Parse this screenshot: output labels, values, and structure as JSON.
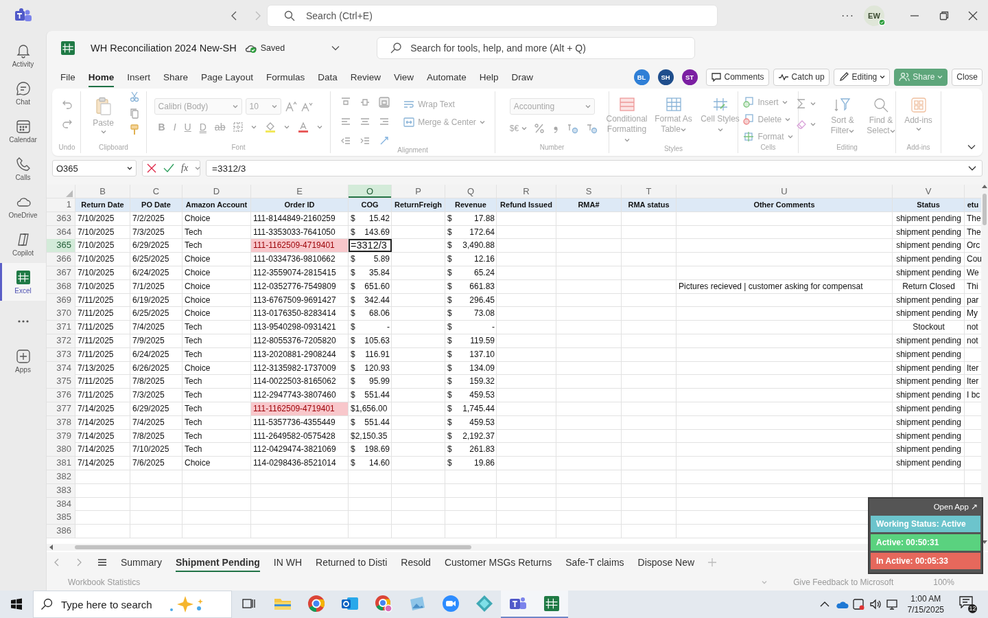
{
  "app_bar": {
    "search_placeholder": "Search (Ctrl+E)",
    "more": "···",
    "avatar": "EW"
  },
  "rail": [
    {
      "kind": "activity",
      "label": "Activity",
      "selected": false
    },
    {
      "kind": "chat",
      "label": "Chat",
      "selected": false
    },
    {
      "kind": "calendar",
      "label": "Calendar",
      "selected": false
    },
    {
      "kind": "calls",
      "label": "Calls",
      "selected": false
    },
    {
      "kind": "onedrive",
      "label": "OneDrive",
      "selected": false
    },
    {
      "kind": "copilot",
      "label": "Copilot",
      "selected": false
    },
    {
      "kind": "excel",
      "label": "Excel",
      "selected": true
    },
    {
      "kind": "more",
      "selected": false
    },
    {
      "kind": "apps",
      "label": "Apps",
      "selected": false
    }
  ],
  "workbook": {
    "title": "WH Reconciliation 2024 New-SH",
    "save_status": "Saved",
    "search_placeholder": "Search for tools, help, and more (Alt + Q)"
  },
  "ribbon_tabs": [
    {
      "label": "File",
      "selected": false
    },
    {
      "label": "Home",
      "selected": true
    },
    {
      "label": "Insert",
      "selected": false
    },
    {
      "label": "Share",
      "selected": false
    },
    {
      "label": "Page Layout",
      "selected": false
    },
    {
      "label": "Formulas",
      "selected": false
    },
    {
      "label": "Data",
      "selected": false
    },
    {
      "label": "Review",
      "selected": false
    },
    {
      "label": "View",
      "selected": false
    },
    {
      "label": "Automate",
      "selected": false
    },
    {
      "label": "Help",
      "selected": false
    },
    {
      "label": "Draw",
      "selected": false
    }
  ],
  "collaborators": [
    {
      "initials": "BL",
      "color": "#2f7fd6"
    },
    {
      "initials": "SH",
      "color": "#1f4e8c"
    },
    {
      "initials": "ST",
      "color": "#7b1fa2"
    }
  ],
  "actions": [
    {
      "kind": "comments",
      "label": "Comments"
    },
    {
      "kind": "catchup",
      "label": "Catch up"
    },
    {
      "kind": "editing",
      "label": "Editing"
    },
    {
      "kind": "share",
      "label": "Share"
    },
    {
      "kind": "close",
      "label": "Close"
    }
  ],
  "ribbon": {
    "groups": [
      {
        "kind": "undo",
        "label": "Undo"
      },
      {
        "kind": "clipboard",
        "label": "Clipboard",
        "paste": "Paste"
      },
      {
        "kind": "font",
        "label": "Font",
        "font": "Calibri (Body)",
        "size": "10",
        "styles": [
          "B",
          "I",
          "U",
          "D",
          "ab"
        ]
      },
      {
        "kind": "alignment",
        "label": "Alignment",
        "wrap": "Wrap Text",
        "merge": "Merge & Center"
      },
      {
        "kind": "number",
        "label": "Number",
        "format": "Accounting",
        "currency": "$€"
      },
      {
        "kind": "styles",
        "label": "Styles",
        "buttons": [
          "Conditional Formatting",
          "Format As Table",
          "Cell Styles"
        ]
      },
      {
        "kind": "cells",
        "label": "Cells",
        "buttons": [
          "Insert",
          "Delete",
          "Format"
        ]
      },
      {
        "kind": "editing",
        "label": "Editing",
        "buttons": [
          "Sort & Filter",
          "Find & Select"
        ]
      },
      {
        "kind": "addins",
        "label": "Add-ins",
        "buttons": [
          "Add-ins"
        ]
      }
    ]
  },
  "formula_bar": {
    "name_box": "O365",
    "function_label": "fx",
    "formula": "=3312/3"
  },
  "sheet": {
    "header_row": "1",
    "columns": [
      {
        "letter": "B",
        "heading": "Return Date",
        "kind": "text",
        "selected": false
      },
      {
        "letter": "C",
        "heading": "PO Date",
        "kind": "text",
        "selected": false
      },
      {
        "letter": "D",
        "heading": "Amazon Account",
        "kind": "text",
        "selected": false
      },
      {
        "letter": "E",
        "heading": "Order ID",
        "kind": "id",
        "selected": false
      },
      {
        "letter": "O",
        "heading": "COG",
        "kind": "money",
        "selected": true
      },
      {
        "letter": "P",
        "heading": "ReturnFreigh",
        "kind": "text",
        "selected": false
      },
      {
        "letter": "Q",
        "heading": "Revenue",
        "kind": "money",
        "selected": false
      },
      {
        "letter": "R",
        "heading": "Refund Issued",
        "kind": "text",
        "selected": false
      },
      {
        "letter": "S",
        "heading": "RMA#",
        "kind": "text",
        "selected": false
      },
      {
        "letter": "T",
        "heading": "RMA status",
        "kind": "text",
        "selected": false
      },
      {
        "letter": "U",
        "heading": "Other Comments",
        "kind": "text",
        "selected": false
      },
      {
        "letter": "V",
        "heading": "Status",
        "kind": "status",
        "selected": false
      },
      {
        "heading": "etu",
        "kind": "text",
        "selected": false
      }
    ],
    "rows": [
      {
        "number": "363",
        "selected": false,
        "highlighted": false,
        "cells": [
          "7/10/2025",
          "7/2/2025",
          "Choice",
          "111-8144849-2160259",
          [
            "$",
            "15.42"
          ],
          null,
          [
            "$",
            "17.88"
          ],
          null,
          null,
          null,
          null,
          "shipment pending",
          "The"
        ]
      },
      {
        "number": "364",
        "selected": false,
        "highlighted": false,
        "cells": [
          "7/10/2025",
          "7/3/2025",
          "Tech",
          "111-3353033-7641050",
          [
            "$",
            "143.69"
          ],
          null,
          [
            "$",
            "172.64"
          ],
          null,
          null,
          null,
          null,
          "shipment pending",
          "The"
        ]
      },
      {
        "number": "365",
        "selected": true,
        "highlighted": true,
        "cells": [
          "7/10/2025",
          "6/29/2025",
          "Tech",
          "111-1162509-4719401",
          "=3312/3",
          null,
          [
            "$",
            "3,490.88"
          ],
          null,
          null,
          null,
          null,
          "shipment pending",
          "Orc"
        ]
      },
      {
        "number": "366",
        "selected": false,
        "highlighted": false,
        "cells": [
          "7/10/2025",
          "6/25/2025",
          "Choice",
          "111-0334736-9810662",
          [
            "$",
            "5.89"
          ],
          null,
          [
            "$",
            "12.16"
          ],
          null,
          null,
          null,
          null,
          "shipment pending",
          "Cou"
        ]
      },
      {
        "number": "367",
        "selected": false,
        "highlighted": false,
        "cells": [
          "7/10/2025",
          "6/24/2025",
          "Choice",
          "112-3559074-2815415",
          [
            "$",
            "35.84"
          ],
          null,
          [
            "$",
            "65.24"
          ],
          null,
          null,
          null,
          null,
          "shipment pending",
          "We"
        ]
      },
      {
        "number": "368",
        "selected": false,
        "highlighted": false,
        "cells": [
          "7/10/2025",
          "7/1/2025",
          "Choice",
          "112-0352776-7549809",
          [
            "$",
            "651.60"
          ],
          null,
          [
            "$",
            "661.83"
          ],
          null,
          null,
          null,
          "Pictures recieved | customer asking for compensat",
          "Return Closed",
          "Thi"
        ]
      },
      {
        "number": "369",
        "selected": false,
        "highlighted": false,
        "cells": [
          "7/11/2025",
          "6/19/2025",
          "Choice",
          "113-6767509-9691427",
          [
            "$",
            "342.44"
          ],
          null,
          [
            "$",
            "296.45"
          ],
          null,
          null,
          null,
          null,
          "shipment pending",
          "par"
        ]
      },
      {
        "number": "370",
        "selected": false,
        "highlighted": false,
        "cells": [
          "7/11/2025",
          "6/25/2025",
          "Choice",
          "113-0176350-8283414",
          [
            "$",
            "68.06"
          ],
          null,
          [
            "$",
            "73.08"
          ],
          null,
          null,
          null,
          null,
          "shipment pending",
          "My"
        ]
      },
      {
        "number": "371",
        "selected": false,
        "highlighted": false,
        "cells": [
          "7/11/2025",
          "7/4/2025",
          "Tech",
          "113-9540298-0931421",
          [
            "$",
            "-"
          ],
          null,
          [
            "$",
            "-"
          ],
          null,
          null,
          null,
          null,
          "Stockout",
          "not"
        ]
      },
      {
        "number": "372",
        "selected": false,
        "highlighted": false,
        "cells": [
          "7/11/2025",
          "7/9/2025",
          "Tech",
          "112-8055376-7205820",
          [
            "$",
            "105.63"
          ],
          null,
          [
            "$",
            "119.59"
          ],
          null,
          null,
          null,
          null,
          "shipment pending",
          "not"
        ]
      },
      {
        "number": "373",
        "selected": false,
        "highlighted": false,
        "cells": [
          "7/11/2025",
          "6/24/2025",
          "Tech",
          "113-2020881-2908244",
          [
            "$",
            "116.91"
          ],
          null,
          [
            "$",
            "137.10"
          ],
          null,
          null,
          null,
          null,
          "shipment pending",
          null
        ]
      },
      {
        "number": "374",
        "selected": false,
        "highlighted": false,
        "cells": [
          "7/13/2025",
          "6/26/2025",
          "Choice",
          "112-3135982-1737009",
          [
            "$",
            "120.93"
          ],
          null,
          [
            "$",
            "134.09"
          ],
          null,
          null,
          null,
          null,
          "shipment pending",
          "Iter"
        ]
      },
      {
        "number": "375",
        "selected": false,
        "highlighted": false,
        "cells": [
          "7/11/2025",
          "7/8/2025",
          "Tech",
          "114-0022503-8165062",
          [
            "$",
            "95.99"
          ],
          null,
          [
            "$",
            "159.32"
          ],
          null,
          null,
          null,
          null,
          "shipment pending",
          "Iter"
        ]
      },
      {
        "number": "376",
        "selected": false,
        "highlighted": false,
        "cells": [
          "7/11/2025",
          "7/3/2025",
          "Tech",
          "112-2947743-3807460",
          [
            "$",
            "551.44"
          ],
          null,
          [
            "$",
            "459.53"
          ],
          null,
          null,
          null,
          null,
          "shipment pending",
          "I bc"
        ]
      },
      {
        "number": "377",
        "selected": false,
        "highlighted": true,
        "cells": [
          "7/14/2025",
          "6/29/2025",
          "Tech",
          "111-1162509-4719401",
          "$1,656.00",
          null,
          [
            "$",
            "1,745.44"
          ],
          null,
          null,
          null,
          null,
          "shipment pending",
          null
        ]
      },
      {
        "number": "378",
        "selected": false,
        "highlighted": false,
        "cells": [
          "7/14/2025",
          "7/4/2025",
          "Tech",
          "111-5357736-4355449",
          [
            "$",
            "551.44"
          ],
          null,
          [
            "$",
            "459.53"
          ],
          null,
          null,
          null,
          null,
          "shipment pending",
          null
        ]
      },
      {
        "number": "379",
        "selected": false,
        "highlighted": false,
        "cells": [
          "7/14/2025",
          "7/8/2025",
          "Tech",
          "111-2649582-0575428",
          "$2,150.35",
          null,
          [
            "$",
            "2,192.37"
          ],
          null,
          null,
          null,
          null,
          "shipment pending",
          null
        ]
      },
      {
        "number": "380",
        "selected": false,
        "highlighted": false,
        "cells": [
          "7/14/2025",
          "7/10/2025",
          "Tech",
          "112-0429474-3821069",
          [
            "$",
            "198.69"
          ],
          null,
          [
            "$",
            "261.83"
          ],
          null,
          null,
          null,
          null,
          "shipment pending",
          null
        ]
      },
      {
        "number": "381",
        "selected": false,
        "highlighted": false,
        "cells": [
          "7/14/2025",
          "7/6/2025",
          "Choice",
          "114-0298436-8521014",
          [
            "$",
            "14.60"
          ],
          null,
          [
            "$",
            "19.86"
          ],
          null,
          null,
          null,
          null,
          "shipment pending",
          null
        ]
      },
      {
        "number": "382",
        "selected": false,
        "highlighted": false
      },
      {
        "number": "383",
        "selected": false,
        "highlighted": false
      },
      {
        "number": "384",
        "selected": false,
        "highlighted": false
      },
      {
        "number": "385",
        "selected": false,
        "highlighted": false
      },
      {
        "number": "386",
        "selected": false,
        "highlighted": false
      }
    ]
  },
  "sheet_tabs": [
    {
      "label": "Summary",
      "selected": false
    },
    {
      "label": "Shipment Pending",
      "selected": true
    },
    {
      "label": "IN WH",
      "selected": false
    },
    {
      "label": "Returned to Disti",
      "selected": false
    },
    {
      "label": "Resold",
      "selected": false
    },
    {
      "label": "Customer MSGs Returns",
      "selected": false
    },
    {
      "label": "Safe-T claims",
      "selected": false
    },
    {
      "label": "Dispose New",
      "selected": false
    }
  ],
  "status_bar": {
    "statistics": "Workbook Statistics",
    "feedback": "Give Feedback to Microsoft",
    "zoom": "100%"
  },
  "timer_widget": {
    "open_label": "Open App ↗",
    "items": [
      {
        "label": "Working Status: Active",
        "color": "#6cc4cc"
      },
      {
        "label": "Active: 00:50:31",
        "color": "#5ad27f"
      },
      {
        "label": "In Active: 00:05:33",
        "color": "#e6685c"
      }
    ]
  },
  "taskbar": {
    "search_placeholder": "Type here to search",
    "apps": [
      {
        "kind": "taskview",
        "open": false
      },
      {
        "kind": "folder",
        "open": false
      },
      {
        "kind": "browser",
        "open": false
      },
      {
        "kind": "mail",
        "open": false
      },
      {
        "kind": "browser2",
        "open": false
      },
      {
        "kind": "photos",
        "open": false
      },
      {
        "kind": "video",
        "open": false
      },
      {
        "kind": "diamond",
        "open": false
      },
      {
        "kind": "teams",
        "open": true
      },
      {
        "kind": "sheet",
        "open": true
      }
    ],
    "time": "1:00 AM",
    "date": "7/15/2025",
    "notifications": "12"
  }
}
